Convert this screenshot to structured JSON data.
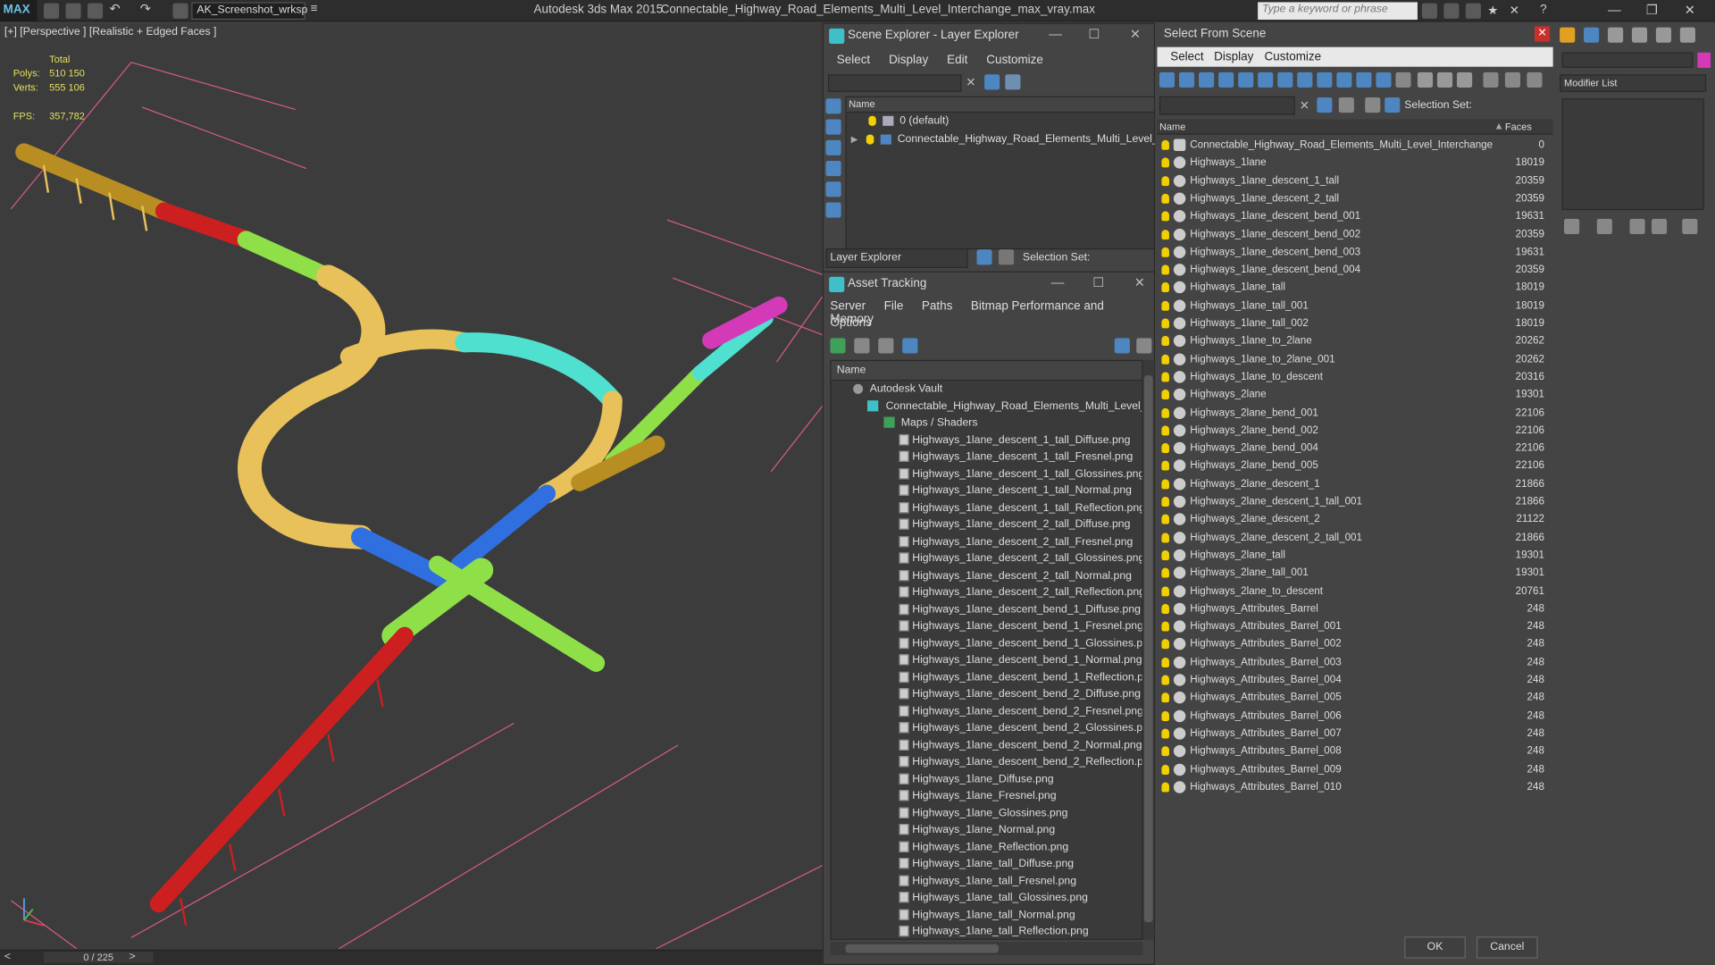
{
  "titlebar": {
    "logo": "MAX",
    "workspace": "AK_Screenshot_wrksp",
    "app_title": "Autodesk 3ds Max  2015",
    "file_title": "Connectable_Highway_Road_Elements_Multi_Level_Interchange_max_vray.max",
    "search_placeholder": "Type a keyword or phrase"
  },
  "viewport": {
    "label": "[+] [Perspective ] [Realistic + Edged Faces ]",
    "stats": {
      "total_label": "Total",
      "polys_label": "Polys:",
      "polys": "510 150",
      "verts_label": "Verts:",
      "verts": "555 106",
      "fps_label": "FPS:",
      "fps": "357,782"
    },
    "colors": {
      "yellow": "#e8c15a",
      "red": "#cc1f1f",
      "green": "#8fe048",
      "cyan": "#4fe0cf",
      "blue": "#2f6fe0",
      "magenta": "#d43ab8",
      "olive": "#b88e22",
      "grid": "#d85a8a"
    }
  },
  "status": {
    "frame": "0 / 225"
  },
  "scene_explorer": {
    "title": "Scene Explorer - Layer Explorer",
    "menu": [
      "Select",
      "Display",
      "Edit",
      "Customize"
    ],
    "column_name": "Name",
    "rows": [
      "0 (default)",
      "Connectable_Highway_Road_Elements_Multi_Level_Inter..."
    ],
    "footer_mode": "Layer Explorer",
    "selection_set_label": "Selection Set:"
  },
  "asset_tracking": {
    "title": "Asset Tracking",
    "menu": [
      "Server",
      "File",
      "Paths",
      "Bitmap Performance and Memory"
    ],
    "menu2": "Options",
    "column_name": "Name",
    "vault": "Autodesk Vault",
    "file": "Connectable_Highway_Road_Elements_Multi_Level_Inte",
    "maps": "Maps / Shaders",
    "files": [
      "Highways_1lane_descent_1_tall_Diffuse.png",
      "Highways_1lane_descent_1_tall_Fresnel.png",
      "Highways_1lane_descent_1_tall_Glossines.png",
      "Highways_1lane_descent_1_tall_Normal.png",
      "Highways_1lane_descent_1_tall_Reflection.png",
      "Highways_1lane_descent_2_tall_Diffuse.png",
      "Highways_1lane_descent_2_tall_Fresnel.png",
      "Highways_1lane_descent_2_tall_Glossines.png",
      "Highways_1lane_descent_2_tall_Normal.png",
      "Highways_1lane_descent_2_tall_Reflection.png",
      "Highways_1lane_descent_bend_1_Diffuse.png",
      "Highways_1lane_descent_bend_1_Fresnel.png",
      "Highways_1lane_descent_bend_1_Glossines.png",
      "Highways_1lane_descent_bend_1_Normal.png",
      "Highways_1lane_descent_bend_1_Reflection.png",
      "Highways_1lane_descent_bend_2_Diffuse.png",
      "Highways_1lane_descent_bend_2_Fresnel.png",
      "Highways_1lane_descent_bend_2_Glossines.png",
      "Highways_1lane_descent_bend_2_Normal.png",
      "Highways_1lane_descent_bend_2_Reflection.png",
      "Highways_1lane_Diffuse.png",
      "Highways_1lane_Fresnel.png",
      "Highways_1lane_Glossines.png",
      "Highways_1lane_Normal.png",
      "Highways_1lane_Reflection.png",
      "Highways_1lane_tall_Diffuse.png",
      "Highways_1lane_tall_Fresnel.png",
      "Highways_1lane_tall_Glossines.png",
      "Highways_1lane_tall_Normal.png",
      "Highways_1lane_tall_Reflection.png"
    ]
  },
  "select_from_scene": {
    "title": "Select From Scene",
    "menu": [
      "Select",
      "Display",
      "Customize"
    ],
    "selection_set_label": "Selection Set:",
    "col_name": "Name",
    "col_faces": "Faces",
    "rows": [
      {
        "name": "Connectable_Highway_Road_Elements_Multi_Level_Interchange",
        "faces": "0"
      },
      {
        "name": "Highways_1lane",
        "faces": "18019"
      },
      {
        "name": "Highways_1lane_descent_1_tall",
        "faces": "20359"
      },
      {
        "name": "Highways_1lane_descent_2_tall",
        "faces": "20359"
      },
      {
        "name": "Highways_1lane_descent_bend_001",
        "faces": "19631"
      },
      {
        "name": "Highways_1lane_descent_bend_002",
        "faces": "20359"
      },
      {
        "name": "Highways_1lane_descent_bend_003",
        "faces": "19631"
      },
      {
        "name": "Highways_1lane_descent_bend_004",
        "faces": "20359"
      },
      {
        "name": "Highways_1lane_tall",
        "faces": "18019"
      },
      {
        "name": "Highways_1lane_tall_001",
        "faces": "18019"
      },
      {
        "name": "Highways_1lane_tall_002",
        "faces": "18019"
      },
      {
        "name": "Highways_1lane_to_2lane",
        "faces": "20262"
      },
      {
        "name": "Highways_1lane_to_2lane_001",
        "faces": "20262"
      },
      {
        "name": "Highways_1lane_to_descent",
        "faces": "20316"
      },
      {
        "name": "Highways_2lane",
        "faces": "19301"
      },
      {
        "name": "Highways_2lane_bend_001",
        "faces": "22106"
      },
      {
        "name": "Highways_2lane_bend_002",
        "faces": "22106"
      },
      {
        "name": "Highways_2lane_bend_004",
        "faces": "22106"
      },
      {
        "name": "Highways_2lane_bend_005",
        "faces": "22106"
      },
      {
        "name": "Highways_2lane_descent_1",
        "faces": "21866"
      },
      {
        "name": "Highways_2lane_descent_1_tall_001",
        "faces": "21866"
      },
      {
        "name": "Highways_2lane_descent_2",
        "faces": "21122"
      },
      {
        "name": "Highways_2lane_descent_2_tall_001",
        "faces": "21866"
      },
      {
        "name": "Highways_2lane_tall",
        "faces": "19301"
      },
      {
        "name": "Highways_2lane_tall_001",
        "faces": "19301"
      },
      {
        "name": "Highways_2lane_to_descent",
        "faces": "20761"
      },
      {
        "name": "Highways_Attributes_Barrel",
        "faces": "248"
      },
      {
        "name": "Highways_Attributes_Barrel_001",
        "faces": "248"
      },
      {
        "name": "Highways_Attributes_Barrel_002",
        "faces": "248"
      },
      {
        "name": "Highways_Attributes_Barrel_003",
        "faces": "248"
      },
      {
        "name": "Highways_Attributes_Barrel_004",
        "faces": "248"
      },
      {
        "name": "Highways_Attributes_Barrel_005",
        "faces": "248"
      },
      {
        "name": "Highways_Attributes_Barrel_006",
        "faces": "248"
      },
      {
        "name": "Highways_Attributes_Barrel_007",
        "faces": "248"
      },
      {
        "name": "Highways_Attributes_Barrel_008",
        "faces": "248"
      },
      {
        "name": "Highways_Attributes_Barrel_009",
        "faces": "248"
      },
      {
        "name": "Highways_Attributes_Barrel_010",
        "faces": "248"
      }
    ],
    "ok": "OK",
    "cancel": "Cancel"
  },
  "command_panel": {
    "modifier_list": "Modifier List"
  }
}
